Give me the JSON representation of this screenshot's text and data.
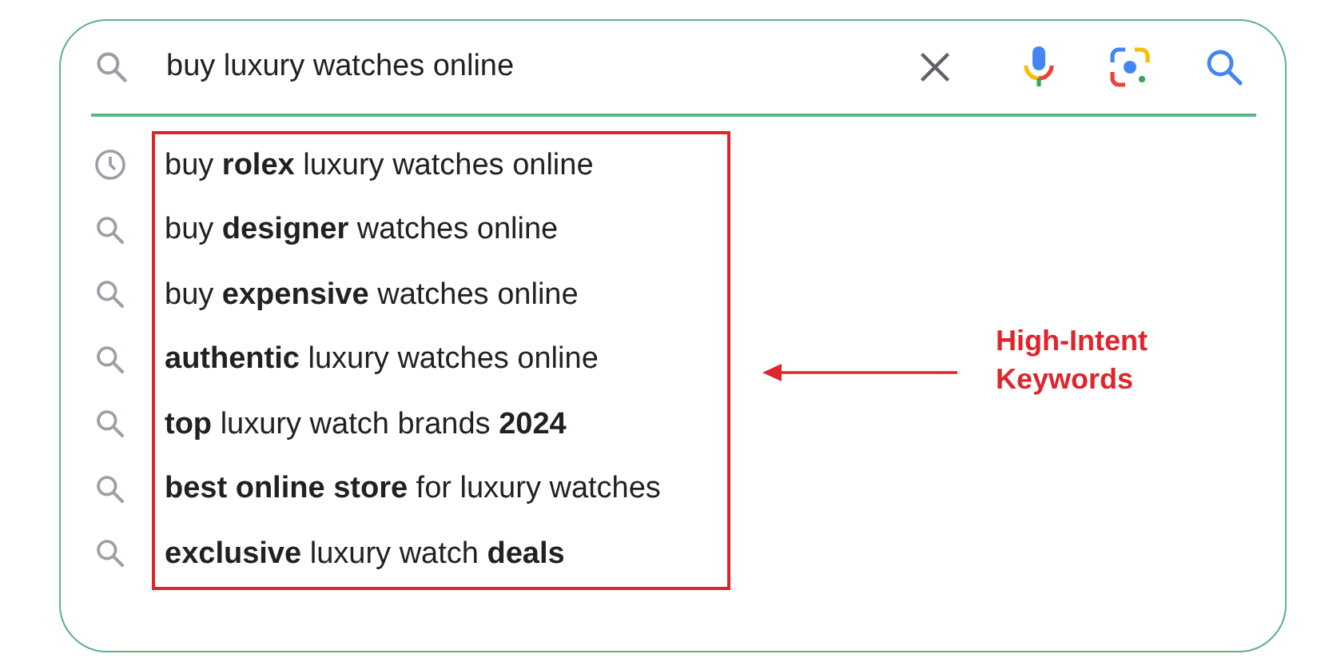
{
  "search": {
    "value": "buy luxury watches online"
  },
  "suggestions": [
    {
      "kind": "history",
      "text": "buy **rolex** luxury watches online"
    },
    {
      "kind": "search",
      "text": "buy **designer** watches online"
    },
    {
      "kind": "search",
      "text": "buy **expensive** watches online"
    },
    {
      "kind": "search",
      "text": "**authentic** luxury watches online"
    },
    {
      "kind": "search",
      "text": "**top** luxury watch brands **2024**"
    },
    {
      "kind": "search",
      "text": "**best online store** for luxury watches"
    },
    {
      "kind": "search",
      "text": "**exclusive** luxury watch **deals**"
    }
  ],
  "annotation": {
    "label": "High-Intent Keywords"
  }
}
